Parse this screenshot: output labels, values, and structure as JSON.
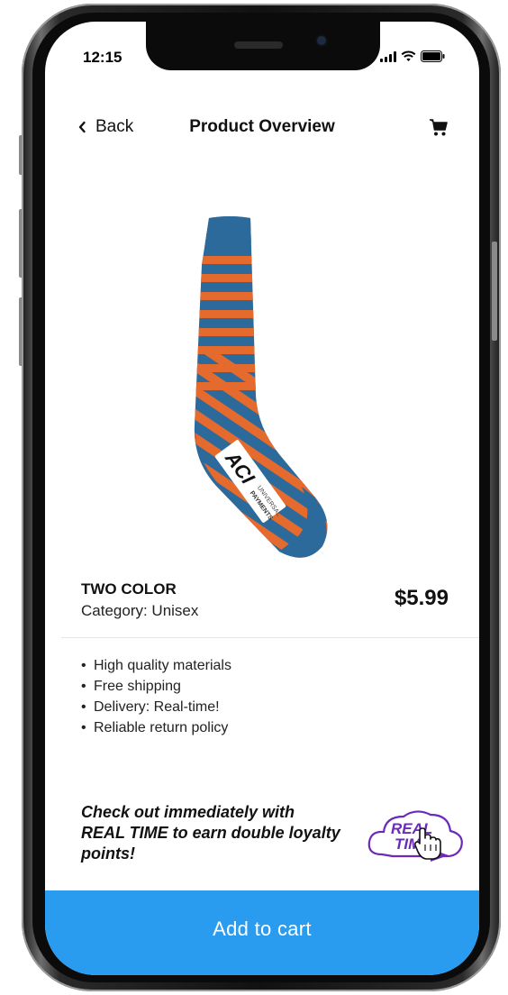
{
  "status_bar": {
    "time": "12:15",
    "icons": [
      "signal-icon",
      "wifi-icon",
      "battery-icon"
    ]
  },
  "nav": {
    "back_label": "Back",
    "title": "Product Overview",
    "cart_icon": "cart-icon"
  },
  "product": {
    "name": "TWO COLOR",
    "category": "Category: Unisex",
    "price": "$5.99",
    "image_label": {
      "brand": "ACI",
      "sub1": "UNIVERSAL",
      "sub2": "PAYMENTS"
    },
    "colors": {
      "primary": "#2b6a9b",
      "stripe": "#e56a2d"
    }
  },
  "features": [
    "High quality materials",
    "Free shipping",
    "Delivery: Real-time!",
    "Reliable return policy"
  ],
  "promo": {
    "text": "Check out immediately with REAL TIME to earn double loyalty points!",
    "logo_line1": "REAL",
    "logo_line2": "TIME",
    "logo_color": "#6b2bb8"
  },
  "cta": {
    "label": "Add to cart",
    "color": "#2a9cf0"
  }
}
